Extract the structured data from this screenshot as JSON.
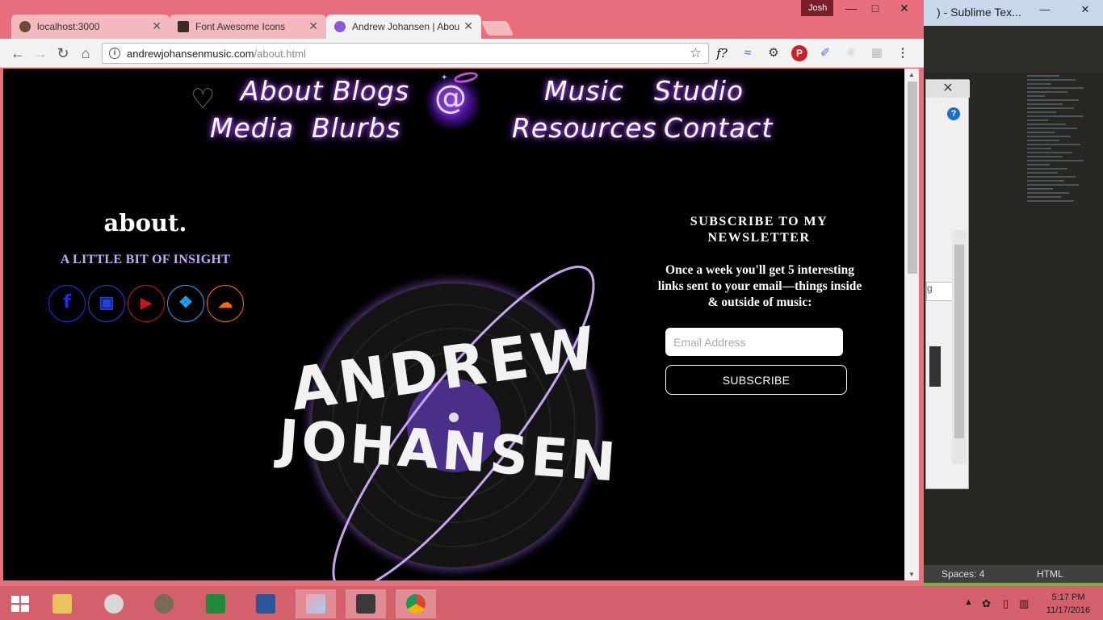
{
  "background_window": {
    "title": ") - Sublime Tex...",
    "status_spaces": "Spaces: 4",
    "status_syntax": "HTML",
    "panel_field_text": "g"
  },
  "browser": {
    "profile_name": "Josh",
    "tabs": [
      {
        "label": "localhost:3000",
        "active": false
      },
      {
        "label": "Font Awesome Icons",
        "active": false
      },
      {
        "label": "Andrew Johansen | Abou",
        "active": true
      }
    ],
    "url_host": "andrewjohansenmusic.com",
    "url_path": "/about.html"
  },
  "page": {
    "nav": {
      "about": "About",
      "blogs": "Blogs",
      "music": "Music",
      "studio": "Studio",
      "media": "Media",
      "blurbs": "Blurbs",
      "resources": "Resources",
      "contact": "Contact"
    },
    "about_title": "about.",
    "about_subtitle": "A LITTLE BIT OF INSIGHT",
    "socials": [
      {
        "name": "facebook",
        "color": "#1a2cff"
      },
      {
        "name": "instagram",
        "color": "#2340d8"
      },
      {
        "name": "youtube",
        "color": "#c4141c"
      },
      {
        "name": "twitter",
        "color": "#1da1f2"
      },
      {
        "name": "soundcloud",
        "color": "#ff6a00"
      }
    ],
    "newsletter": {
      "title": "SUBSCRIBE TO MY NEWSLETTER",
      "body": "Once a week you'll get 5 interesting links sent to your email—things inside & outside of music:",
      "email_placeholder": "Email Address",
      "button": "SUBSCRIBE"
    },
    "accent_color": "#b05cff"
  },
  "taskbar": {
    "time": "5:17 PM",
    "date": "11/17/2016"
  }
}
